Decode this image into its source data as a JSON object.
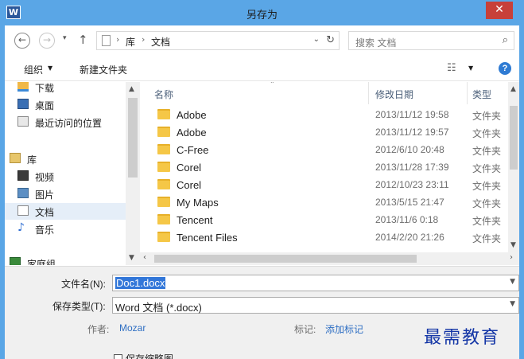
{
  "window": {
    "title": "另存为",
    "app_icon": "word-icon",
    "close_symbol": "✕",
    "title_bar_color": "#5aa6e6",
    "close_button_color": "#c7403a"
  },
  "navigation": {
    "back_symbol": "←",
    "forward_symbol": "→",
    "recent_symbol": "▾",
    "up_symbol": "↑",
    "address": {
      "separator": "›",
      "segments": [
        "库",
        "文档"
      ],
      "dropdown_symbol": "⌄",
      "refresh_symbol": "↻"
    },
    "search": {
      "placeholder": "搜索 文档",
      "icon_symbol": "⌕"
    }
  },
  "toolbar": {
    "organize_label": "组织",
    "organize_arrow": "▼",
    "new_folder_label": "新建文件夹",
    "view_symbol": "☷",
    "view_arrow": "▼",
    "help_symbol": "?"
  },
  "nav_pane": {
    "items": [
      {
        "label": "下载",
        "icon": "downloads-icon"
      },
      {
        "label": "桌面",
        "icon": "desktop-icon"
      },
      {
        "label": "最近访问的位置",
        "icon": "recent-places-icon"
      },
      {
        "label": "库",
        "icon": "libraries-icon"
      },
      {
        "label": "视频",
        "icon": "videos-icon"
      },
      {
        "label": "图片",
        "icon": "pictures-icon"
      },
      {
        "label": "文档",
        "icon": "documents-icon",
        "selected": true
      },
      {
        "label": "音乐",
        "icon": "music-icon"
      },
      {
        "label": "家庭组",
        "icon": "homegroup-icon"
      }
    ],
    "music_glyph": "♪",
    "scroll_up": "▲",
    "scroll_down": "▼"
  },
  "file_list": {
    "columns": {
      "name": "名称",
      "date": "修改日期",
      "type": "类型"
    },
    "sort_arrow": "⌃",
    "rows": [
      {
        "name": "Adobe",
        "date": "2013/11/12 19:58",
        "type": "文件夹"
      },
      {
        "name": "Adobe",
        "date": "2013/11/12 19:57",
        "type": "文件夹"
      },
      {
        "name": "C-Free",
        "date": "2012/6/10 20:48",
        "type": "文件夹"
      },
      {
        "name": "Corel",
        "date": "2013/11/28 17:39",
        "type": "文件夹"
      },
      {
        "name": "Corel",
        "date": "2012/10/23 23:11",
        "type": "文件夹"
      },
      {
        "name": "My Maps",
        "date": "2013/5/15 21:47",
        "type": "文件夹"
      },
      {
        "name": "Tencent",
        "date": "2013/11/6 0:18",
        "type": "文件夹"
      },
      {
        "name": "Tencent Files",
        "date": "2014/2/20 21:26",
        "type": "文件夹"
      }
    ],
    "scroll_up": "▲",
    "scroll_down": "▼",
    "scroll_left": "‹",
    "scroll_right": "›"
  },
  "form": {
    "filename_label": "文件名(N):",
    "filename_value": "Doc1.docx",
    "savetype_label": "保存类型(T):",
    "savetype_value": "Word 文档 (*.docx)",
    "dropdown_symbol": "▼",
    "author_label": "作者:",
    "author_value": "Mozar",
    "tags_label": "标记:",
    "tags_value": "添加标记",
    "thumbnail_label": "保存缩略图"
  },
  "watermark": "最需教育"
}
